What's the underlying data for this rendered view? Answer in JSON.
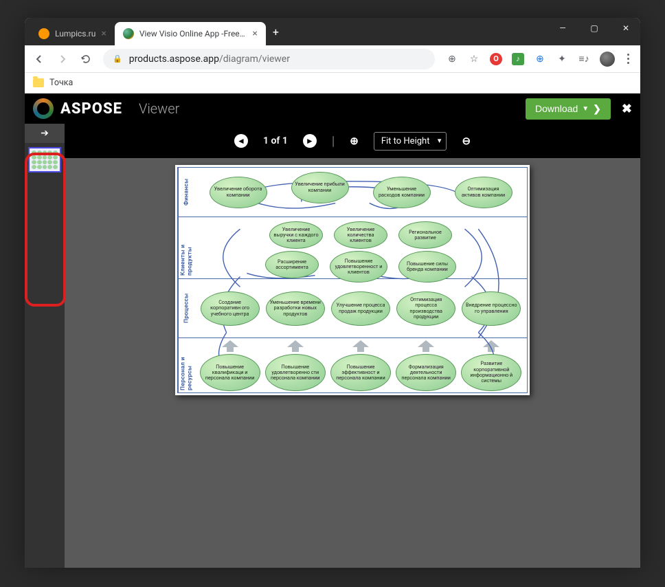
{
  "window_controls": {
    "min": "—",
    "max": "▢",
    "close": "✕"
  },
  "tabs": [
    {
      "label": "Lumpics.ru",
      "active": false
    },
    {
      "label": "View Visio Online App -Free Onli",
      "active": true
    }
  ],
  "nav": {
    "url_host": "products.aspose.app",
    "url_path": "/diagram/viewer"
  },
  "bookmarks": {
    "item1": "Точка"
  },
  "app": {
    "brand": "ASPOSE",
    "title": "Viewer",
    "download_label": "Download",
    "toolbar": {
      "page_indicator": "1 of 1",
      "fit_label": "Fit to Height"
    }
  },
  "diagram": {
    "rows": [
      {
        "label": "Финансы",
        "cells": [
          "Увеличение оборота компании",
          "Увеличение прибыли компании",
          "Уменьшение расходов компании",
          "Оптимизация активов компании"
        ]
      },
      {
        "label": "Клиенты и продукты",
        "top": [
          "Увеличение выручки с каждого клиента",
          "Увеличение количества клиентов",
          "Региональное развитие"
        ],
        "bottom": [
          "Расширение ассортимента",
          "Повышение удовлетворенност и клиентов",
          "Повышение силы бренда компании"
        ]
      },
      {
        "label": "Процессы",
        "cells": [
          "Создание корпоративн ого учебного центра",
          "Уменьшение времени разработки новых продуктов",
          "Улучшение процесса продаж продукции",
          "Оптимизация процесса производства продукции",
          "Внедрение процессно го управления"
        ]
      },
      {
        "label": "Персонал и ресурсы",
        "cells": [
          "Повышение квалификаци и персонала компании",
          "Повышение удовлетворенно сти персонала компании",
          "Повышение эффективност и персонала компании",
          "Формализация деятельности персонала компании",
          "Развитие корпоративной информационно й системы"
        ]
      }
    ]
  }
}
